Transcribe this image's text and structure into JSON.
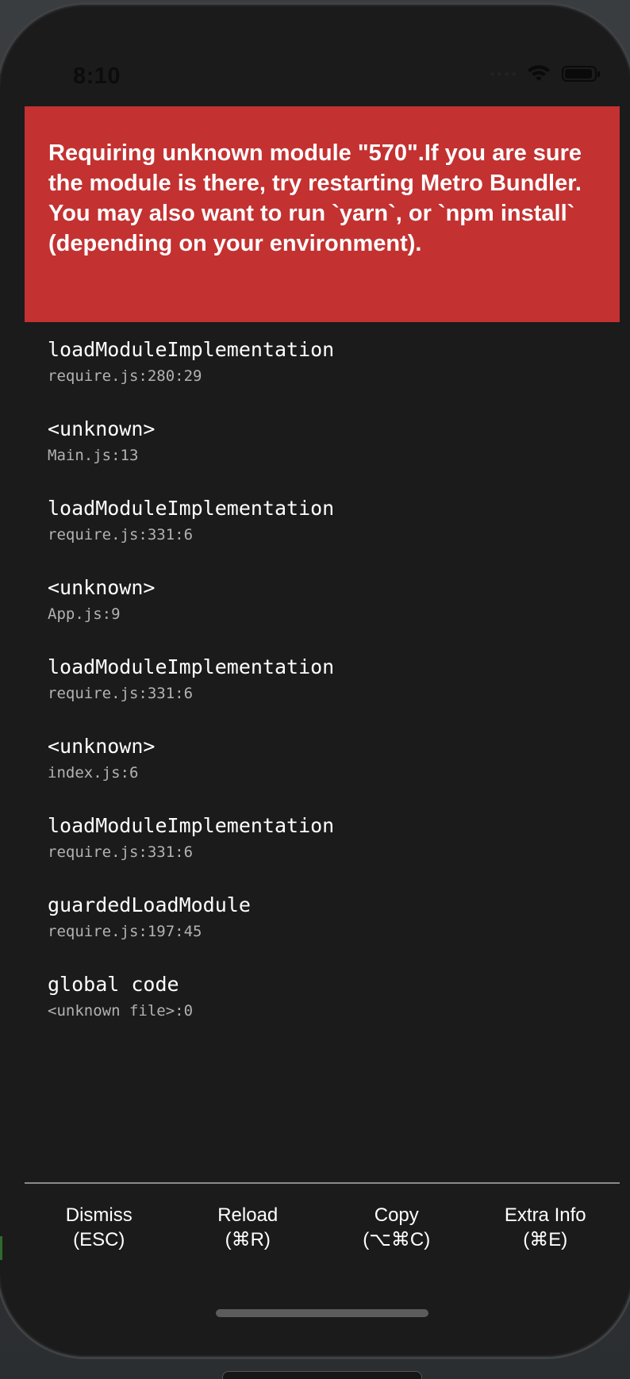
{
  "status_bar": {
    "time": "8:10",
    "icons": [
      "signal-dots-icon",
      "wifi-icon",
      "battery-icon"
    ]
  },
  "error": {
    "message": "Requiring unknown module \"570\".If you are sure the module is there, try restarting Metro Bundler. You may also want to run `yarn`, or `npm install` (depending on your environment).",
    "banner_color": "#c33131"
  },
  "stack_trace": [
    {
      "method": "loadModuleImplementation",
      "file": "require.js:280:29"
    },
    {
      "method": "<unknown>",
      "file": "Main.js:13"
    },
    {
      "method": "loadModuleImplementation",
      "file": "require.js:331:6"
    },
    {
      "method": "<unknown>",
      "file": "App.js:9"
    },
    {
      "method": "loadModuleImplementation",
      "file": "require.js:331:6"
    },
    {
      "method": "<unknown>",
      "file": "index.js:6"
    },
    {
      "method": "loadModuleImplementation",
      "file": "require.js:331:6"
    },
    {
      "method": "guardedLoadModule",
      "file": "require.js:197:45"
    },
    {
      "method": "global code",
      "file": "<unknown file>:0"
    }
  ],
  "footer": {
    "buttons": [
      {
        "label": "Dismiss",
        "shortcut": "(ESC)"
      },
      {
        "label": "Reload",
        "shortcut": "(⌘R)"
      },
      {
        "label": "Copy",
        "shortcut": "(⌥⌘C)"
      },
      {
        "label": "Extra Info",
        "shortcut": "(⌘E)"
      }
    ]
  },
  "colors": {
    "background": "#1b1b1b",
    "error_banner": "#c33131",
    "file_text": "#b2b2b2"
  }
}
